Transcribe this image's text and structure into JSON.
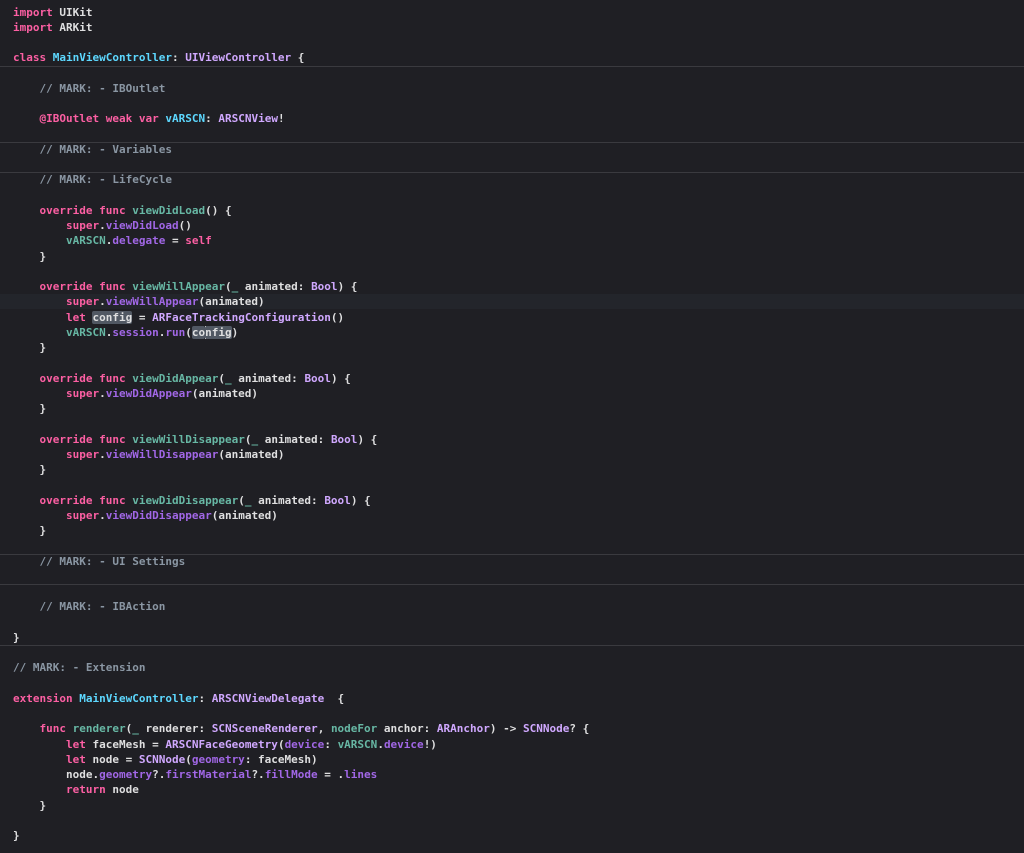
{
  "editor": {
    "language": "Swift",
    "theme": "dark",
    "colors": {
      "background": "#1f1f24",
      "keyword": "#fc5fa3",
      "declared_class": "#5dd8ff",
      "type": "#d0a8ff",
      "function": "#67b7a4",
      "member": "#a167e6",
      "comment": "#8a96a3",
      "text": "#dfdfe0"
    },
    "current_line_index": 19,
    "lines": [
      {
        "indent": "",
        "tokens": [
          {
            "t": "import",
            "c": "kw"
          },
          {
            "t": " UIKit",
            "c": "plain"
          }
        ]
      },
      {
        "indent": "",
        "tokens": [
          {
            "t": "import",
            "c": "kw"
          },
          {
            "t": " ARKit",
            "c": "plain"
          }
        ]
      },
      {
        "indent": "",
        "tokens": []
      },
      {
        "indent": "",
        "tokens": [
          {
            "t": "class",
            "c": "kw"
          },
          {
            "t": " ",
            "c": "plain"
          },
          {
            "t": "MainViewController",
            "c": "cls"
          },
          {
            "t": ": ",
            "c": "plain"
          },
          {
            "t": "UIViewController",
            "c": "typ"
          },
          {
            "t": " {",
            "c": "plain"
          }
        ]
      },
      {
        "indent": "",
        "tokens": []
      },
      {
        "indent": "    ",
        "tokens": [
          {
            "t": "// MARK: - IBOutlet",
            "c": "cm"
          }
        ]
      },
      {
        "indent": "",
        "tokens": []
      },
      {
        "indent": "    ",
        "tokens": [
          {
            "t": "@IBOutlet",
            "c": "kw"
          },
          {
            "t": " ",
            "c": "plain"
          },
          {
            "t": "weak",
            "c": "kw"
          },
          {
            "t": " ",
            "c": "plain"
          },
          {
            "t": "var",
            "c": "kw"
          },
          {
            "t": " ",
            "c": "plain"
          },
          {
            "t": "vARSCN",
            "c": "cls"
          },
          {
            "t": ": ",
            "c": "plain"
          },
          {
            "t": "ARSCNView",
            "c": "typ"
          },
          {
            "t": "!",
            "c": "plain"
          }
        ]
      },
      {
        "indent": "",
        "tokens": []
      },
      {
        "indent": "    ",
        "tokens": [
          {
            "t": "// MARK: - Variables",
            "c": "cm"
          }
        ]
      },
      {
        "indent": "",
        "tokens": []
      },
      {
        "indent": "    ",
        "tokens": [
          {
            "t": "// MARK: - LifeCycle",
            "c": "cm"
          }
        ]
      },
      {
        "indent": "",
        "tokens": []
      },
      {
        "indent": "    ",
        "tokens": [
          {
            "t": "override",
            "c": "kw"
          },
          {
            "t": " ",
            "c": "plain"
          },
          {
            "t": "func",
            "c": "kw"
          },
          {
            "t": " ",
            "c": "plain"
          },
          {
            "t": "viewDidLoad",
            "c": "fn"
          },
          {
            "t": "() {",
            "c": "plain"
          }
        ]
      },
      {
        "indent": "        ",
        "tokens": [
          {
            "t": "super",
            "c": "kw"
          },
          {
            "t": ".",
            "c": "plain"
          },
          {
            "t": "viewDidLoad",
            "c": "mem"
          },
          {
            "t": "()",
            "c": "plain"
          }
        ]
      },
      {
        "indent": "        ",
        "tokens": [
          {
            "t": "vARSCN",
            "c": "fn"
          },
          {
            "t": ".",
            "c": "plain"
          },
          {
            "t": "delegate",
            "c": "mem"
          },
          {
            "t": " = ",
            "c": "plain"
          },
          {
            "t": "self",
            "c": "kw"
          }
        ]
      },
      {
        "indent": "    ",
        "tokens": [
          {
            "t": "}",
            "c": "plain"
          }
        ]
      },
      {
        "indent": "",
        "tokens": []
      },
      {
        "indent": "    ",
        "tokens": [
          {
            "t": "override",
            "c": "kw"
          },
          {
            "t": " ",
            "c": "plain"
          },
          {
            "t": "func",
            "c": "kw"
          },
          {
            "t": " ",
            "c": "plain"
          },
          {
            "t": "viewWillAppear",
            "c": "fn"
          },
          {
            "t": "(",
            "c": "plain"
          },
          {
            "t": "_",
            "c": "fn"
          },
          {
            "t": " animated: ",
            "c": "plain"
          },
          {
            "t": "Bool",
            "c": "typ"
          },
          {
            "t": ") {",
            "c": "plain"
          }
        ]
      },
      {
        "indent": "        ",
        "tokens": [
          {
            "t": "super",
            "c": "kw"
          },
          {
            "t": ".",
            "c": "plain"
          },
          {
            "t": "viewWillAppear",
            "c": "mem"
          },
          {
            "t": "(animated)",
            "c": "plain"
          }
        ]
      },
      {
        "indent": "        ",
        "tokens": [
          {
            "t": "let",
            "c": "kw"
          },
          {
            "t": " ",
            "c": "plain"
          },
          {
            "t": "config",
            "c": "plain",
            "hl": true
          },
          {
            "t": " = ",
            "c": "plain"
          },
          {
            "t": "ARFaceTrackingConfiguration",
            "c": "typ"
          },
          {
            "t": "()",
            "c": "plain"
          }
        ]
      },
      {
        "indent": "        ",
        "tokens": [
          {
            "t": "vARSCN",
            "c": "fn"
          },
          {
            "t": ".",
            "c": "plain"
          },
          {
            "t": "session",
            "c": "mem"
          },
          {
            "t": ".",
            "c": "plain"
          },
          {
            "t": "run",
            "c": "mem"
          },
          {
            "t": "(",
            "c": "plain"
          },
          {
            "t": "co",
            "c": "plain",
            "hl": true,
            "caret": true
          },
          {
            "t": "nfig",
            "c": "plain",
            "hl": true
          },
          {
            "t": ")",
            "c": "plain"
          }
        ]
      },
      {
        "indent": "    ",
        "tokens": [
          {
            "t": "}",
            "c": "plain"
          }
        ]
      },
      {
        "indent": "",
        "tokens": []
      },
      {
        "indent": "    ",
        "tokens": [
          {
            "t": "override",
            "c": "kw"
          },
          {
            "t": " ",
            "c": "plain"
          },
          {
            "t": "func",
            "c": "kw"
          },
          {
            "t": " ",
            "c": "plain"
          },
          {
            "t": "viewDidAppear",
            "c": "fn"
          },
          {
            "t": "(",
            "c": "plain"
          },
          {
            "t": "_",
            "c": "fn"
          },
          {
            "t": " animated: ",
            "c": "plain"
          },
          {
            "t": "Bool",
            "c": "typ"
          },
          {
            "t": ") {",
            "c": "plain"
          }
        ]
      },
      {
        "indent": "        ",
        "tokens": [
          {
            "t": "super",
            "c": "kw"
          },
          {
            "t": ".",
            "c": "plain"
          },
          {
            "t": "viewDidAppear",
            "c": "mem"
          },
          {
            "t": "(animated)",
            "c": "plain"
          }
        ]
      },
      {
        "indent": "    ",
        "tokens": [
          {
            "t": "}",
            "c": "plain"
          }
        ]
      },
      {
        "indent": "",
        "tokens": []
      },
      {
        "indent": "    ",
        "tokens": [
          {
            "t": "override",
            "c": "kw"
          },
          {
            "t": " ",
            "c": "plain"
          },
          {
            "t": "func",
            "c": "kw"
          },
          {
            "t": " ",
            "c": "plain"
          },
          {
            "t": "viewWillDisappear",
            "c": "fn"
          },
          {
            "t": "(",
            "c": "plain"
          },
          {
            "t": "_",
            "c": "fn"
          },
          {
            "t": " animated: ",
            "c": "plain"
          },
          {
            "t": "Bool",
            "c": "typ"
          },
          {
            "t": ") {",
            "c": "plain"
          }
        ]
      },
      {
        "indent": "        ",
        "tokens": [
          {
            "t": "super",
            "c": "kw"
          },
          {
            "t": ".",
            "c": "plain"
          },
          {
            "t": "viewWillDisappear",
            "c": "mem"
          },
          {
            "t": "(animated)",
            "c": "plain"
          }
        ]
      },
      {
        "indent": "    ",
        "tokens": [
          {
            "t": "}",
            "c": "plain"
          }
        ]
      },
      {
        "indent": "",
        "tokens": []
      },
      {
        "indent": "    ",
        "tokens": [
          {
            "t": "override",
            "c": "kw"
          },
          {
            "t": " ",
            "c": "plain"
          },
          {
            "t": "func",
            "c": "kw"
          },
          {
            "t": " ",
            "c": "plain"
          },
          {
            "t": "viewDidDisappear",
            "c": "fn"
          },
          {
            "t": "(",
            "c": "plain"
          },
          {
            "t": "_",
            "c": "fn"
          },
          {
            "t": " animated: ",
            "c": "plain"
          },
          {
            "t": "Bool",
            "c": "typ"
          },
          {
            "t": ") {",
            "c": "plain"
          }
        ]
      },
      {
        "indent": "        ",
        "tokens": [
          {
            "t": "super",
            "c": "kw"
          },
          {
            "t": ".",
            "c": "plain"
          },
          {
            "t": "viewDidDisappear",
            "c": "mem"
          },
          {
            "t": "(animated)",
            "c": "plain"
          }
        ]
      },
      {
        "indent": "    ",
        "tokens": [
          {
            "t": "}",
            "c": "plain"
          }
        ]
      },
      {
        "indent": "",
        "tokens": []
      },
      {
        "indent": "    ",
        "tokens": [
          {
            "t": "// MARK: - UI Settings",
            "c": "cm"
          }
        ]
      },
      {
        "indent": "",
        "tokens": []
      },
      {
        "indent": "",
        "tokens": []
      },
      {
        "indent": "    ",
        "tokens": [
          {
            "t": "// MARK: - IBAction",
            "c": "cm"
          }
        ]
      },
      {
        "indent": "",
        "tokens": []
      },
      {
        "indent": "",
        "tokens": [
          {
            "t": "}",
            "c": "plain"
          }
        ]
      },
      {
        "indent": "",
        "tokens": []
      },
      {
        "indent": "",
        "tokens": [
          {
            "t": "// MARK: - Extension",
            "c": "cm"
          }
        ]
      },
      {
        "indent": "",
        "tokens": []
      },
      {
        "indent": "",
        "tokens": [
          {
            "t": "extension",
            "c": "kw"
          },
          {
            "t": " ",
            "c": "plain"
          },
          {
            "t": "MainViewController",
            "c": "cls"
          },
          {
            "t": ": ",
            "c": "plain"
          },
          {
            "t": "ARSCNViewDelegate",
            "c": "typ"
          },
          {
            "t": "  {",
            "c": "plain"
          }
        ]
      },
      {
        "indent": "",
        "tokens": []
      },
      {
        "indent": "    ",
        "tokens": [
          {
            "t": "func",
            "c": "kw"
          },
          {
            "t": " ",
            "c": "plain"
          },
          {
            "t": "renderer",
            "c": "fn"
          },
          {
            "t": "(",
            "c": "plain"
          },
          {
            "t": "_",
            "c": "fn"
          },
          {
            "t": " renderer: ",
            "c": "plain"
          },
          {
            "t": "SCNSceneRenderer",
            "c": "typ"
          },
          {
            "t": ", ",
            "c": "plain"
          },
          {
            "t": "nodeFor",
            "c": "fn"
          },
          {
            "t": " anchor: ",
            "c": "plain"
          },
          {
            "t": "ARAnchor",
            "c": "typ"
          },
          {
            "t": ") -> ",
            "c": "plain"
          },
          {
            "t": "SCNNode",
            "c": "typ"
          },
          {
            "t": "? {",
            "c": "plain"
          }
        ]
      },
      {
        "indent": "        ",
        "tokens": [
          {
            "t": "let",
            "c": "kw"
          },
          {
            "t": " faceMesh = ",
            "c": "plain"
          },
          {
            "t": "ARSCNFaceGeometry",
            "c": "typ"
          },
          {
            "t": "(",
            "c": "plain"
          },
          {
            "t": "device",
            "c": "mem"
          },
          {
            "t": ": ",
            "c": "plain"
          },
          {
            "t": "vARSCN",
            "c": "fn"
          },
          {
            "t": ".",
            "c": "plain"
          },
          {
            "t": "device",
            "c": "mem"
          },
          {
            "t": "!)",
            "c": "plain"
          }
        ]
      },
      {
        "indent": "        ",
        "tokens": [
          {
            "t": "let",
            "c": "kw"
          },
          {
            "t": " node = ",
            "c": "plain"
          },
          {
            "t": "SCNNode",
            "c": "typ"
          },
          {
            "t": "(",
            "c": "plain"
          },
          {
            "t": "geometry",
            "c": "mem"
          },
          {
            "t": ": faceMesh)",
            "c": "plain"
          }
        ]
      },
      {
        "indent": "        ",
        "tokens": [
          {
            "t": "node.",
            "c": "plain"
          },
          {
            "t": "geometry",
            "c": "mem"
          },
          {
            "t": "?.",
            "c": "plain"
          },
          {
            "t": "firstMaterial",
            "c": "mem"
          },
          {
            "t": "?.",
            "c": "plain"
          },
          {
            "t": "fillMode",
            "c": "mem"
          },
          {
            "t": " = .",
            "c": "plain"
          },
          {
            "t": "lines",
            "c": "mem"
          }
        ]
      },
      {
        "indent": "        ",
        "tokens": [
          {
            "t": "return",
            "c": "kw"
          },
          {
            "t": " node",
            "c": "plain"
          }
        ]
      },
      {
        "indent": "    ",
        "tokens": [
          {
            "t": "}",
            "c": "plain"
          }
        ]
      },
      {
        "indent": "",
        "tokens": []
      },
      {
        "indent": "",
        "tokens": [
          {
            "t": "}",
            "c": "plain"
          }
        ]
      }
    ]
  }
}
